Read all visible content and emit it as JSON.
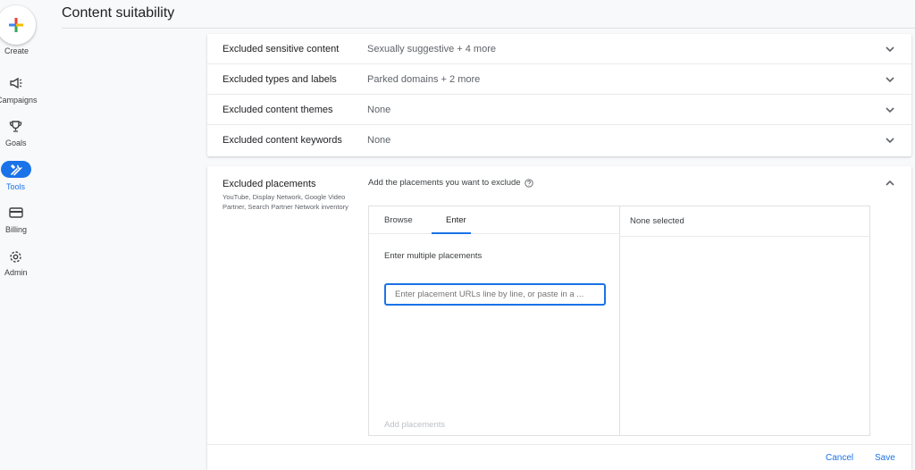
{
  "header": {
    "title": "Content suitability"
  },
  "rail": {
    "create_label": "Create",
    "items": [
      {
        "label": "Campaigns",
        "icon": "megaphone-icon"
      },
      {
        "label": "Goals",
        "icon": "trophy-icon"
      },
      {
        "label": "Tools",
        "icon": "tools-icon"
      },
      {
        "label": "Billing",
        "icon": "credit-card-icon"
      },
      {
        "label": "Admin",
        "icon": "gear-icon"
      }
    ]
  },
  "rows": [
    {
      "title": "Excluded sensitive content",
      "value": "Sexually suggestive + 4 more"
    },
    {
      "title": "Excluded types and labels",
      "value": "Parked domains + 2 more"
    },
    {
      "title": "Excluded content themes",
      "value": "None"
    },
    {
      "title": "Excluded content keywords",
      "value": "None"
    }
  ],
  "placements": {
    "title": "Excluded placements",
    "description": "YouTube, Display Network, Google Video Partner, Search Partner Network inventory",
    "prompt": "Add the placements you want to exclude",
    "tabs": {
      "browse": "Browse",
      "enter": "Enter"
    },
    "enter_label": "Enter multiple placements",
    "input_placeholder": "Enter placement URLs line by line, or paste in a ...",
    "add_label": "Add placements",
    "selected_label": "None selected"
  },
  "footer": {
    "cancel": "Cancel",
    "save": "Save"
  },
  "colors": {
    "accent": "#1a73e8"
  }
}
